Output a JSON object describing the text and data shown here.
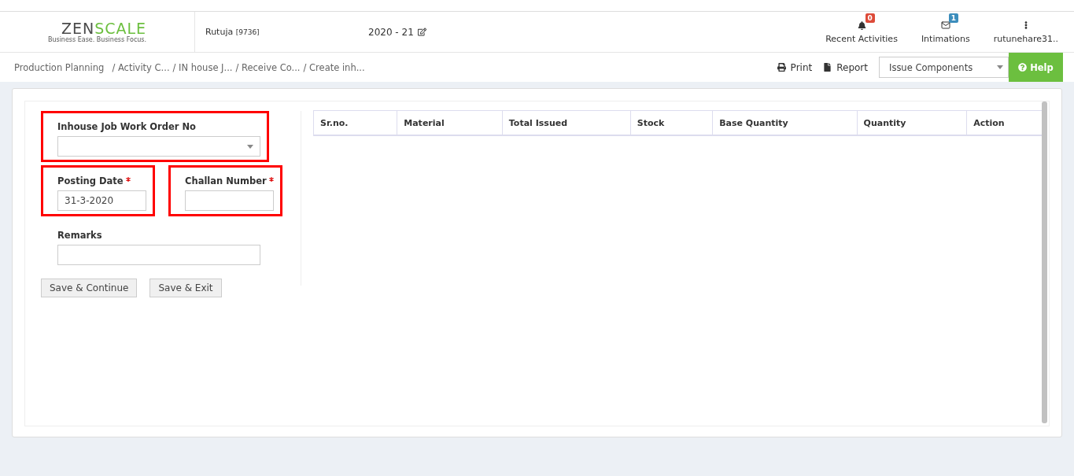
{
  "header": {
    "logo": {
      "word_left": "ZEN",
      "word_right": "SCALE",
      "tagline": "Business Ease. Business Focus."
    },
    "user": {
      "name": "Rutuja",
      "code": "[9736]"
    },
    "year": "2020 - 21",
    "nav": [
      {
        "kind": "bell",
        "label": "Recent Activities",
        "count": "0",
        "color": "#dd4b39"
      },
      {
        "kind": "mail",
        "label": "Intimations",
        "count": "1",
        "color": "#3c8dbc"
      },
      {
        "kind": "more",
        "label": "rutunehare31.."
      }
    ]
  },
  "breadcrumb": [
    "Production Planning",
    "/ Activity C...",
    "/ IN house J...",
    "/ Receive Co...",
    "/ Create inh..."
  ],
  "toolbar": {
    "print": "Print",
    "report": "Report",
    "select": "Issue Components",
    "help": "Help"
  },
  "form": {
    "fields": [
      {
        "kind": "select",
        "label": "Inhouse Job Work Order No",
        "required": false,
        "highlighted": true
      },
      {
        "kind": "text",
        "label": "Posting Date",
        "required": true,
        "value": "31-3-2020",
        "highlighted": true
      },
      {
        "kind": "text",
        "label": "Challan Number",
        "required": true,
        "highlighted": true
      },
      {
        "kind": "text",
        "label": "Remarks",
        "required": false,
        "highlighted": false
      }
    ],
    "buttons": [
      "Save & Continue",
      "Save & Exit"
    ]
  },
  "table": {
    "columns": [
      "Sr.no.",
      "Material",
      "Total Issued",
      "Stock",
      "Base Quantity",
      "Quantity",
      "Action"
    ]
  }
}
